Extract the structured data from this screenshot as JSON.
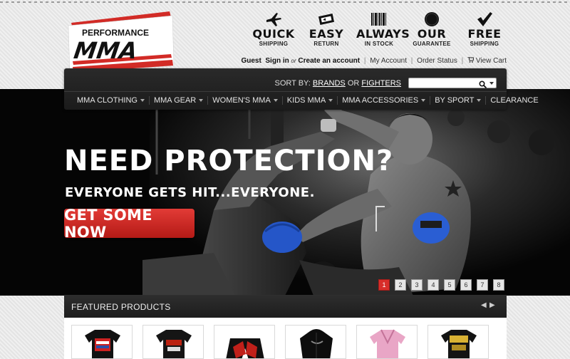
{
  "logo": {
    "line1": "PERFORMANCE",
    "line2": "MMA",
    "brand_red": "#d22b26"
  },
  "features": [
    {
      "icon": "airplane-icon",
      "main": "QUICK",
      "sub": "SHIPPING"
    },
    {
      "icon": "return-ticket-icon",
      "main": "EASY",
      "sub": "RETURN"
    },
    {
      "icon": "barcode-icon",
      "main": "ALWAYS",
      "sub": "IN STOCK"
    },
    {
      "icon": "medal-icon",
      "main": "OUR",
      "sub": "GUARANTEE"
    },
    {
      "icon": "checkmark-icon",
      "main": "FREE",
      "sub": "SHIPPING"
    }
  ],
  "account": {
    "greeting": "Guest",
    "sign_in": "Sign in",
    "or": "or",
    "create": "Create an account",
    "my_account": "My Account",
    "order_status": "Order Status",
    "view_cart": "View Cart"
  },
  "nav": {
    "sort_by_label": "SORT BY:",
    "brands": "BRANDS",
    "or": "OR",
    "fighters": "FIGHTERS",
    "search_placeholder": "",
    "menu": [
      {
        "label": "MMA CLOTHING",
        "caret": true
      },
      {
        "label": "MMA GEAR",
        "caret": true
      },
      {
        "label": "WOMEN'S MMA",
        "caret": true
      },
      {
        "label": "KIDS MMA",
        "caret": true
      },
      {
        "label": "MMA ACCESSORIES",
        "caret": true
      },
      {
        "label": "BY SPORT",
        "caret": true
      },
      {
        "label": "CLEARANCE",
        "caret": false
      }
    ]
  },
  "hero": {
    "title": "NEED PROTECTION?",
    "subtitle": "EVERYONE GETS HIT...EVERYONE.",
    "cta": "GET SOME NOW",
    "slides": [
      "1",
      "2",
      "3",
      "4",
      "5",
      "6",
      "7",
      "8"
    ],
    "active_slide": "1"
  },
  "featured": {
    "title": "FEATURED PRODUCTS",
    "products": [
      {
        "name": "broadway-tshirt"
      },
      {
        "name": "team-tshirt"
      },
      {
        "name": "fight-shorts"
      },
      {
        "name": "black-hoodie"
      },
      {
        "name": "pink-gi"
      },
      {
        "name": "elite-tshirt"
      }
    ]
  },
  "colors": {
    "accent_red": "#d72e2a",
    "nav_bg": "#222222",
    "hero_bg": "#050505"
  }
}
